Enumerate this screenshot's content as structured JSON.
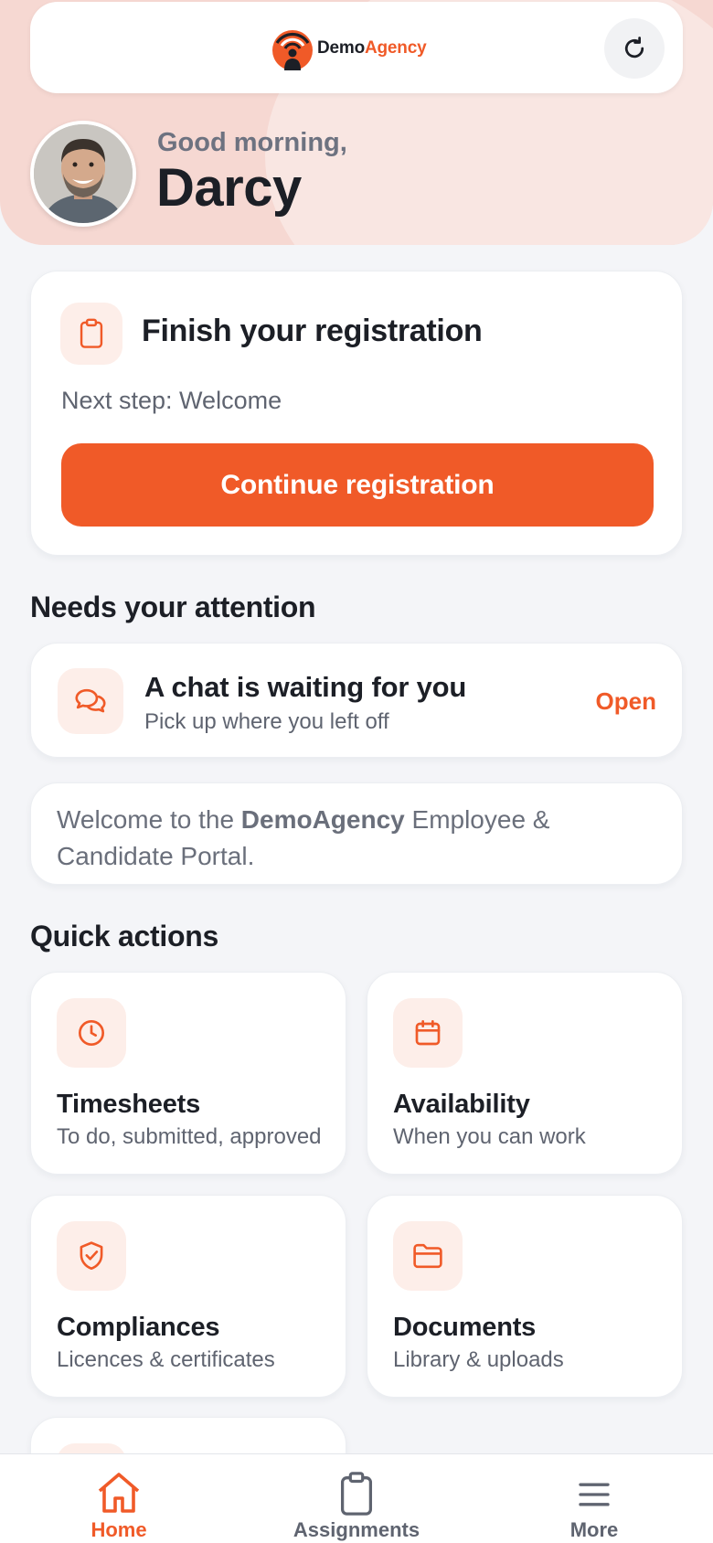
{
  "colors": {
    "accent": "#f05a28",
    "hero_bg": "#f6d8d2",
    "page_bg": "#f4f5f8"
  },
  "header": {
    "logo_part1": "Demo",
    "logo_part2": "Agency",
    "refresh_icon": "refresh-icon"
  },
  "greeting": {
    "salutation": "Good morning,",
    "name": "Darcy"
  },
  "registration": {
    "icon": "clipboard-icon",
    "title": "Finish your registration",
    "next_step": "Next step: Welcome",
    "button_label": "Continue registration"
  },
  "attention": {
    "section_title": "Needs your attention",
    "chat": {
      "icon": "chat-bubbles-icon",
      "title": "A chat is waiting for you",
      "subtitle": "Pick up where you left off",
      "action": "Open"
    }
  },
  "welcome": {
    "prefix": "Welcome to the ",
    "brand": "DemoAgency",
    "suffix": " Employee & Candidate Portal."
  },
  "quick_actions": {
    "section_title": "Quick actions",
    "items": [
      {
        "icon": "clock-icon",
        "title": "Timesheets",
        "subtitle": "To do, submitted, approved"
      },
      {
        "icon": "calendar-icon",
        "title": "Availability",
        "subtitle": "When you can work"
      },
      {
        "icon": "shield-check-icon",
        "title": "Compliances",
        "subtitle": "Licences & certificates"
      },
      {
        "icon": "folder-icon",
        "title": "Documents",
        "subtitle": "Library & uploads"
      }
    ]
  },
  "bottom_nav": {
    "items": [
      {
        "icon": "home-icon",
        "label": "Home",
        "active": true
      },
      {
        "icon": "clipboard-icon",
        "label": "Assignments",
        "active": false
      },
      {
        "icon": "menu-icon",
        "label": "More",
        "active": false
      }
    ]
  }
}
